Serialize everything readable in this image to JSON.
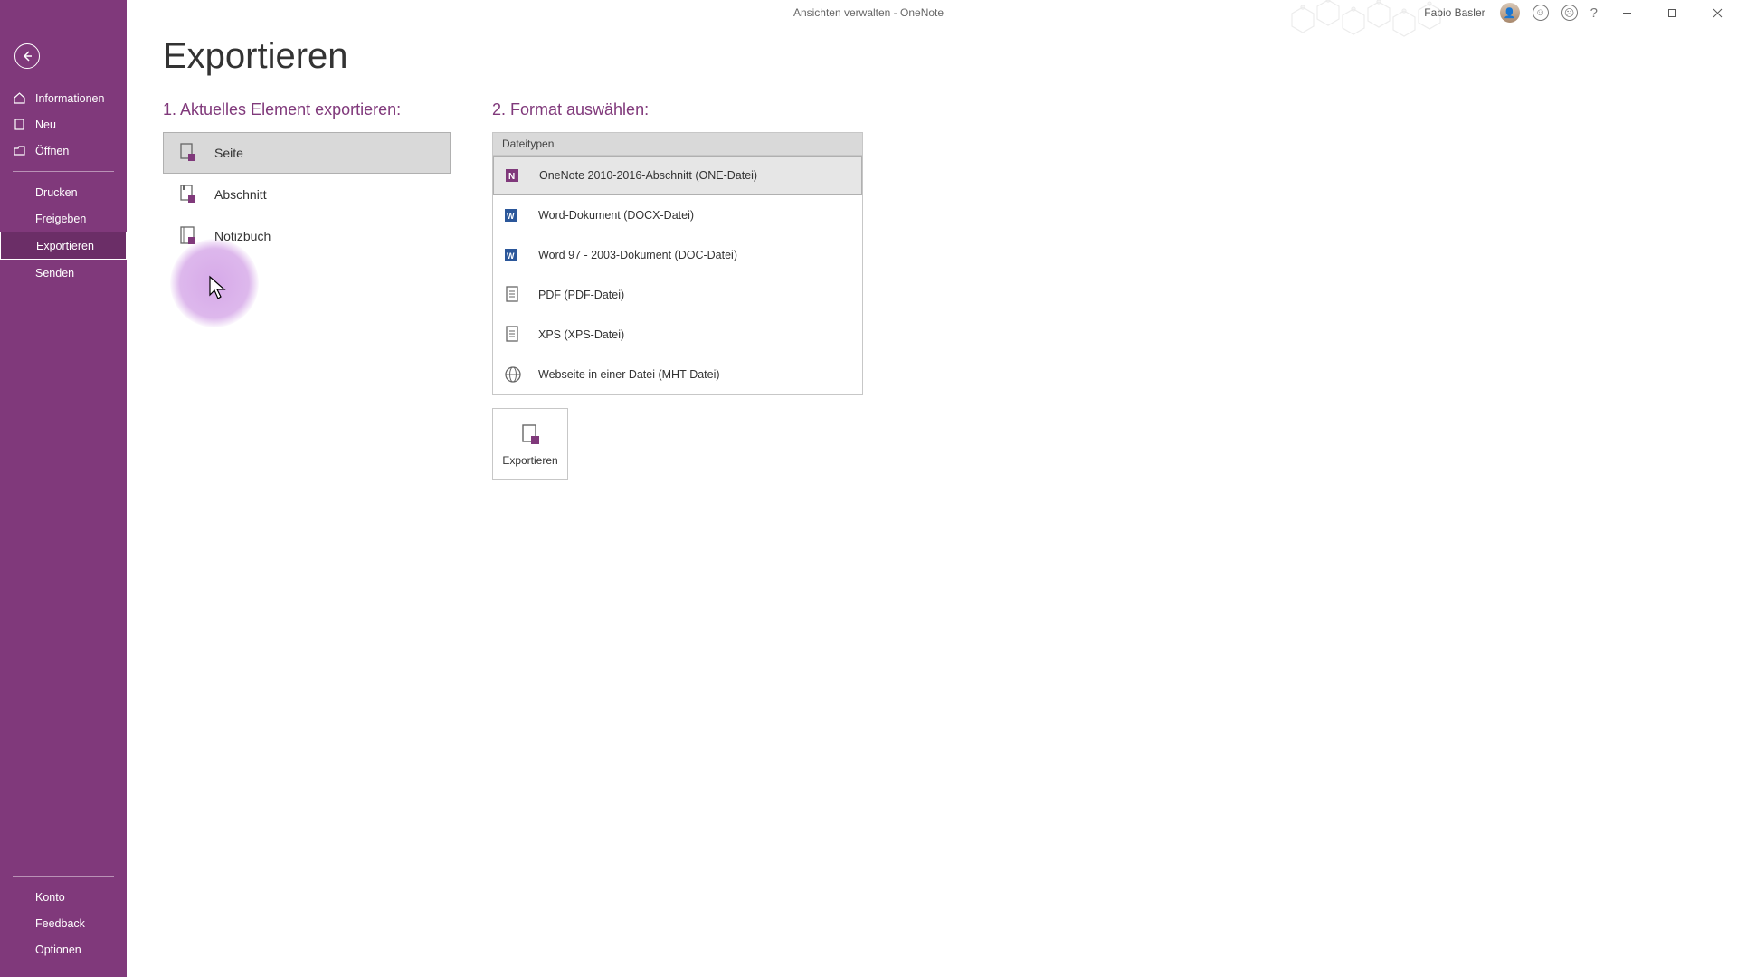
{
  "window": {
    "title": "Ansichten verwalten  -  OneNote",
    "user_name": "Fabio Basler"
  },
  "sidebar": {
    "top_items": [
      {
        "label": "Informationen",
        "icon": "home"
      },
      {
        "label": "Neu",
        "icon": "doc"
      },
      {
        "label": "Öffnen",
        "icon": "folder"
      }
    ],
    "mid_items": [
      {
        "label": "Drucken"
      },
      {
        "label": "Freigeben"
      },
      {
        "label": "Exportieren",
        "selected": true
      },
      {
        "label": "Senden"
      }
    ],
    "bottom_items": [
      {
        "label": "Konto"
      },
      {
        "label": "Feedback"
      },
      {
        "label": "Optionen"
      }
    ]
  },
  "page": {
    "title": "Exportieren",
    "section1_heading": "1. Aktuelles Element exportieren:",
    "section2_heading": "2. Format auswählen:",
    "element_items": [
      {
        "label": "Seite",
        "selected": true
      },
      {
        "label": "Abschnitt"
      },
      {
        "label": "Notizbuch"
      }
    ],
    "format_header": "Dateitypen",
    "format_items": [
      {
        "label": "OneNote 2010-2016-Abschnitt (ONE-Datei)",
        "icon": "onenote",
        "selected": true
      },
      {
        "label": "Word-Dokument (DOCX-Datei)",
        "icon": "word"
      },
      {
        "label": "Word 97 - 2003-Dokument (DOC-Datei)",
        "icon": "word"
      },
      {
        "label": "PDF (PDF-Datei)",
        "icon": "doc"
      },
      {
        "label": "XPS (XPS-Datei)",
        "icon": "doc"
      },
      {
        "label": "Webseite in einer Datei (MHT-Datei)",
        "icon": "web"
      }
    ],
    "export_button_label": "Exportieren"
  }
}
